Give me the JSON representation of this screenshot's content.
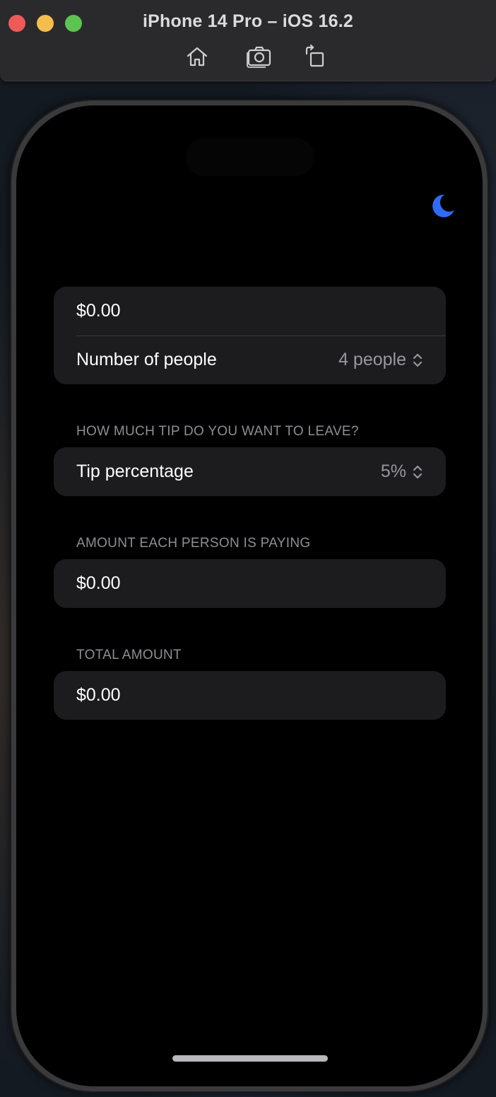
{
  "window": {
    "title": "iPhone 14 Pro – iOS 16.2",
    "toolbar_icons": [
      "home-icon",
      "screenshot-icon",
      "rotate-icon"
    ]
  },
  "app": {
    "theme_toggle_icon": "moon-icon",
    "accent_color": "#2f6bf5",
    "bill": {
      "amount_value": "$0.00",
      "people_label": "Number of people",
      "people_value": "4 people"
    },
    "tip": {
      "header": "HOW MUCH TIP DO YOU WANT TO LEAVE?",
      "label": "Tip percentage",
      "value": "5%"
    },
    "per_person": {
      "header": "AMOUNT EACH PERSON IS PAYING",
      "value": "$0.00"
    },
    "total": {
      "header": "TOTAL AMOUNT",
      "value": "$0.00"
    }
  }
}
